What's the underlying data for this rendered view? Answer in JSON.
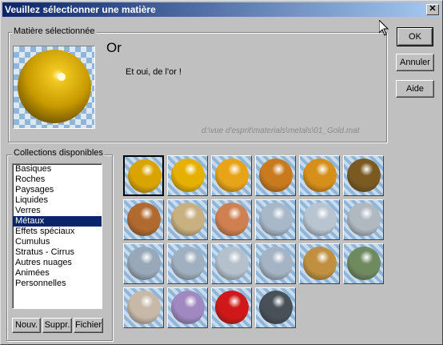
{
  "window": {
    "title": "Veuillez sélectionner une matière",
    "close_glyph": "✕"
  },
  "selected_group": {
    "legend": "Matière sélectionnée",
    "name": "Or",
    "description": "Et oui, de l'or !",
    "path": "d:\\vue d'esprit\\materials\\metals\\01_Gold.mat"
  },
  "buttons": {
    "ok": "OK",
    "cancel": "Annuler",
    "help": "Aide"
  },
  "collections": {
    "legend": "Collections disponibles",
    "items": [
      "Basiques",
      "Roches",
      "Paysages",
      "Liquides",
      "Verres",
      "Métaux",
      "Effets spéciaux",
      "Cumulus",
      "Stratus - Cirrus",
      "Autres nuages",
      "Animées",
      "Personnelles"
    ],
    "selected": "Métaux",
    "new_button": "Nouv.",
    "delete_button": "Suppr.",
    "file_button": "Fichier"
  },
  "materials": [
    {
      "color": "#d9a400",
      "selected": true
    },
    {
      "color": "#e6b000"
    },
    {
      "color": "#e8a418"
    },
    {
      "color": "#c97a1e"
    },
    {
      "color": "#d68f1a"
    },
    {
      "color": "#7a5a20"
    },
    {
      "color": "#b06a30"
    },
    {
      "color": "#c8b080"
    },
    {
      "color": "#d08050"
    },
    {
      "color": "#a8b8c8"
    },
    {
      "color": "#b8c4d0"
    },
    {
      "color": "#b0b8c0"
    },
    {
      "color": "#98a8b8"
    },
    {
      "color": "#a0b0c0"
    },
    {
      "color": "#b4c0cc"
    },
    {
      "color": "#a4b4c4"
    },
    {
      "color": "#c09040"
    },
    {
      "color": "#708a60"
    },
    {
      "color": "#c8b8a8"
    },
    {
      "color": "#a088c0"
    },
    {
      "color": "#d01818"
    },
    {
      "color": "#485058"
    }
  ]
}
